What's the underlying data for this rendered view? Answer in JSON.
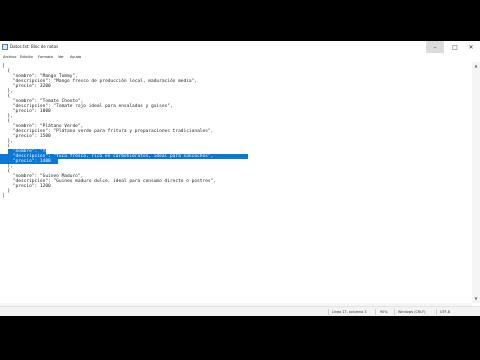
{
  "window": {
    "title": "Datos.txt: Bloc de notas"
  },
  "controls": {
    "minimize": "–",
    "maximize": "□",
    "close": "✕"
  },
  "menu": [
    "Archivo",
    "Edición",
    "Formato",
    "Ver",
    "Ayuda"
  ],
  "editor": {
    "lines": [
      "[",
      "  {",
      "    \"nombre\": \"Mango Tommy\",",
      "    \"descripcion\": \"Mango fresco de producción local, maduración media\",",
      "    \"precio\": 3200",
      "  },",
      "  {",
      "    \"nombre\": \"Tomate Chonto\",",
      "    \"descripcion\": \"Tomate rojo ideal para ensaladas y guisos\",",
      "    \"precio\": 1800",
      "  },",
      "  {",
      "    \"nombre\": \"Plátano Verde\",",
      "    \"descripcion\": \"Plátano verde para fritura y preparaciones tradicionales\",",
      "    \"precio\": 1500",
      "  },",
      "  {",
      "    \"nombre\": \"Yuca\",",
      "    \"descripcion\": \"Yuca fresca, rica en carbohidratos, ideal para sancochos\",",
      "    \"precio\": 1400",
      "  },",
      "  {",
      "    \"nombre\": \"Guineo Maduro\",",
      "    \"descripcion\": \"Guineo maduro dulce, ideal para consumo directo o postres\",",
      "    \"precio\": 1200",
      "  }",
      "]"
    ],
    "selected_lines": [
      17,
      18,
      19
    ]
  },
  "status": {
    "position": "Línea 17, columna 3",
    "zoom": "90%",
    "line_ending": "Windows (CRLF)",
    "encoding": "UTF-8"
  },
  "colors": {
    "selection": "#0a78d7",
    "letterbox": "#000000"
  }
}
